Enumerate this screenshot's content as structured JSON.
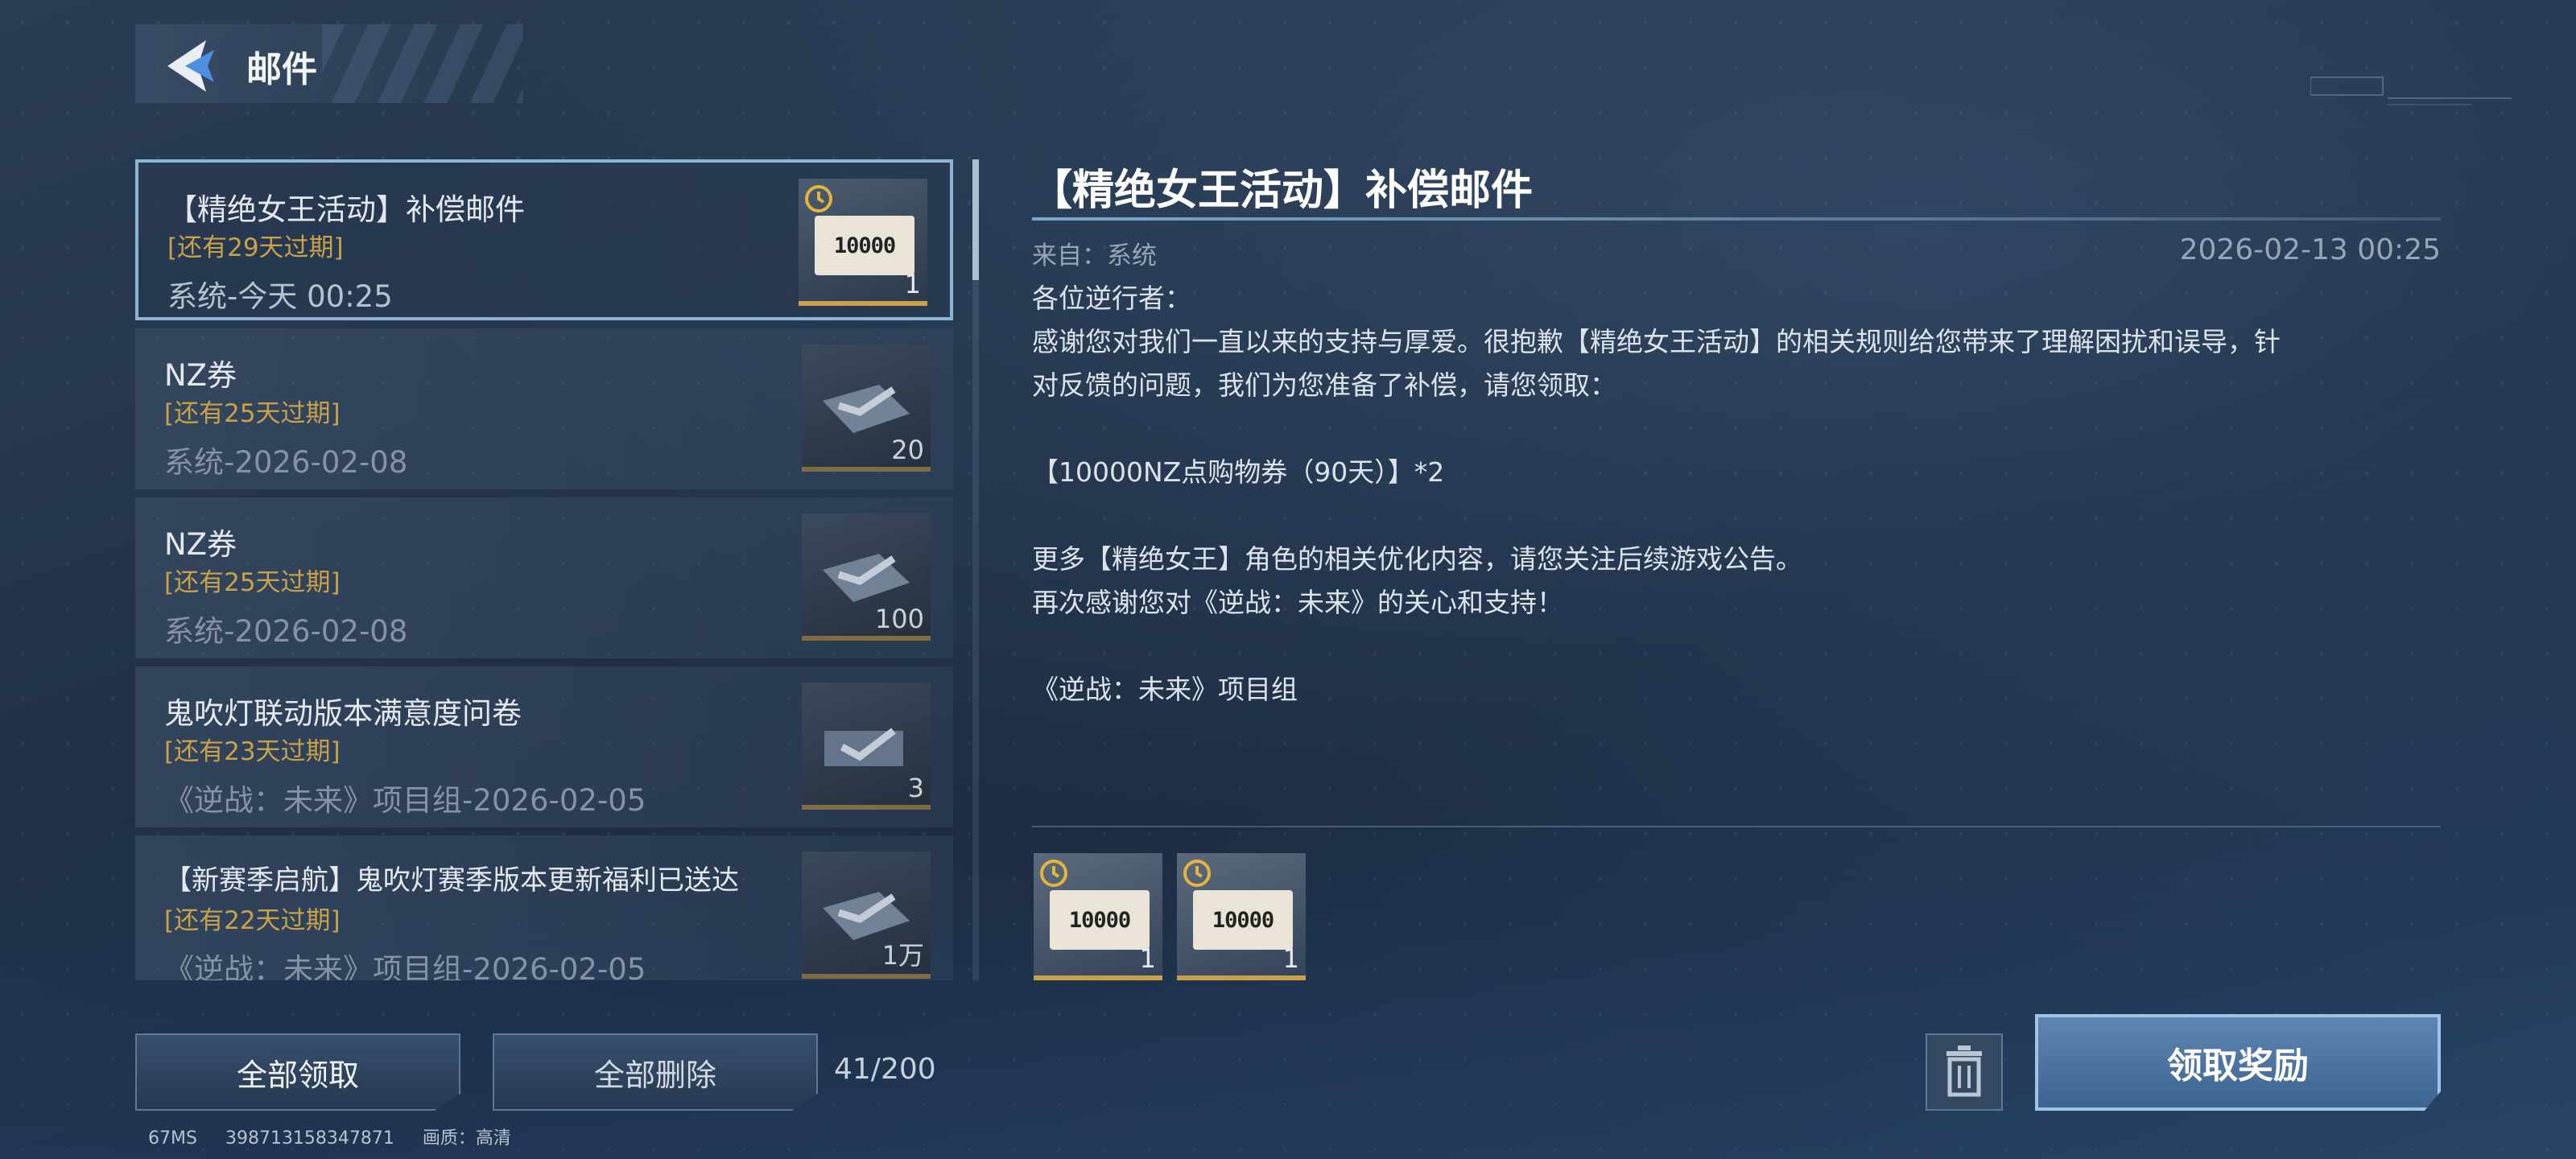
{
  "header": {
    "title": "邮件"
  },
  "mail_list": {
    "items": [
      {
        "title": "【精绝女王活动】补偿邮件",
        "expire": "[还有29天过期]",
        "meta": "系统-今天 00:25",
        "count": "1",
        "thumb_text": "10000",
        "icon": "clock-icon",
        "selected": true
      },
      {
        "title": "NZ券",
        "expire": "[还有25天过期]",
        "meta": "系统-2026-02-08",
        "count": "20",
        "icon": "nz-voucher-icon",
        "selected": false
      },
      {
        "title": "NZ券",
        "expire": "[还有25天过期]",
        "meta": "系统-2026-02-08",
        "count": "100",
        "icon": "nz-voucher-icon",
        "selected": false
      },
      {
        "title": "鬼吹灯联动版本满意度问卷",
        "expire": "[还有23天过期]",
        "meta": "《逆战：未来》项目组-2026-02-05",
        "count": "3",
        "icon": "nz-voucher-icon",
        "selected": false
      },
      {
        "title": "【新赛季启航】鬼吹灯赛季版本更新福利已送达",
        "expire": "[还有22天过期]",
        "meta": "《逆战：未来》项目组-2026-02-05",
        "count": "1万",
        "icon": "nz-voucher-icon",
        "selected": false
      }
    ]
  },
  "detail": {
    "title": "【精绝女王活动】补偿邮件",
    "from": "来自：系统",
    "date": "2026-02-13 00:25",
    "body": "各位逆行者：\n感谢您对我们一直以来的支持与厚爱。很抱歉【精绝女王活动】的相关规则给您带来了理解困扰和误导，针对反馈的问题，我们为您准备了补偿，请您领取：\n\n【10000NZ点购物券（90天）】*2\n\n更多【精绝女王】角色的相关优化内容，请您关注后续游戏公告。\n再次感谢您对《逆战：未来》的关心和支持！\n\n《逆战：未来》项目组",
    "rewards": [
      {
        "thumb_text": "10000",
        "count": "1"
      },
      {
        "thumb_text": "10000",
        "count": "1"
      }
    ]
  },
  "footer": {
    "claim_all": "全部领取",
    "delete_all": "全部删除",
    "mail_count": "41/200",
    "claim_reward": "领取奖励"
  },
  "status_bar": {
    "ping": "67MS",
    "id": "398713158347871",
    "quality": "画质：高清"
  },
  "colors": {
    "accent": "#8eb4d4",
    "expire": "#c8a24a",
    "button": "#3d6390"
  }
}
